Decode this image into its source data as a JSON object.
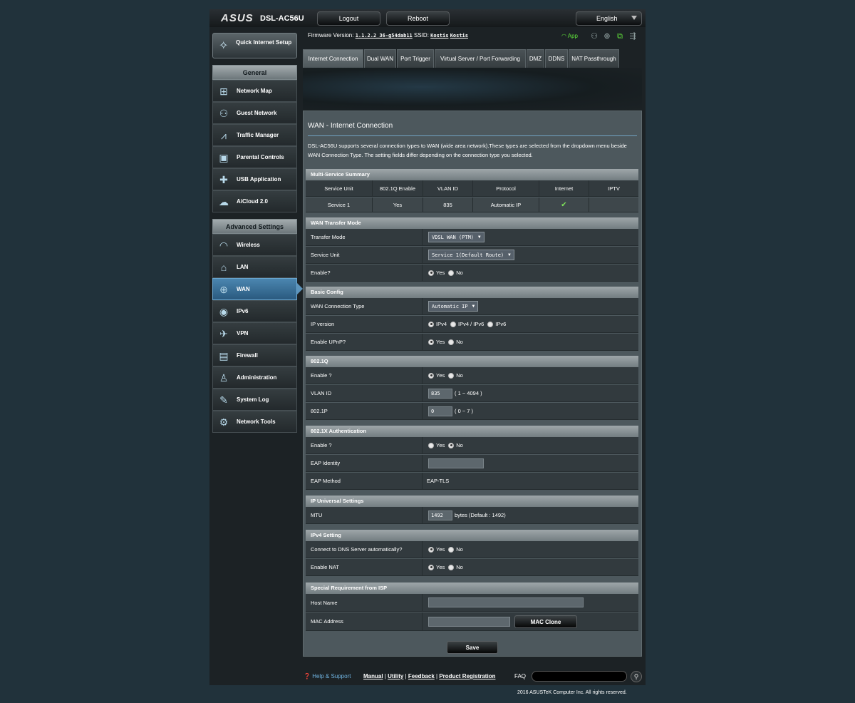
{
  "header": {
    "brand": "ASUS",
    "model": "DSL-AC56U",
    "logout_label": "Logout",
    "reboot_label": "Reboot",
    "language": "English"
  },
  "status_bar": {
    "firmware_label": "Firmware Version:",
    "firmware_value": "1.1.2.2_36-g54dab11",
    "ssid_label": "SSID:",
    "ssid_1": "Kostis",
    "ssid_2": "Kostis",
    "app_label": "App"
  },
  "sidebar": {
    "quick_setup_label": "Quick Internet Setup",
    "general_heading": "General",
    "general_items": [
      {
        "label": "Network Map"
      },
      {
        "label": "Guest Network"
      },
      {
        "label": "Traffic Manager"
      },
      {
        "label": "Parental Controls"
      },
      {
        "label": "USB Application"
      },
      {
        "label": "AiCloud 2.0"
      }
    ],
    "advanced_heading": "Advanced Settings",
    "advanced_items": [
      {
        "label": "Wireless"
      },
      {
        "label": "LAN"
      },
      {
        "label": "WAN"
      },
      {
        "label": "IPv6"
      },
      {
        "label": "VPN"
      },
      {
        "label": "Firewall"
      },
      {
        "label": "Administration"
      },
      {
        "label": "System Log"
      },
      {
        "label": "Network Tools"
      }
    ]
  },
  "tabs": [
    "Internet Connection",
    "Dual WAN",
    "Port Trigger",
    "Virtual Server / Port Forwarding",
    "DMZ",
    "DDNS",
    "NAT Passthrough"
  ],
  "page": {
    "title": "WAN - Internet Connection",
    "description": "DSL-AC56U supports several connection types to WAN (wide area network).These types are selected from the dropdown menu beside WAN Connection Type. The setting fields differ depending on the connection type you selected."
  },
  "multi_service": {
    "heading": "Multi-Service Summary",
    "columns": [
      "Service Unit",
      "802.1Q Enable",
      "VLAN ID",
      "Protocol",
      "Internet",
      "IPTV"
    ],
    "row": {
      "service_unit": "Service 1",
      "q_enable": "Yes",
      "vlan_id": "835",
      "protocol": "Automatic IP",
      "iptv": ""
    }
  },
  "wan_transfer": {
    "heading": "WAN Transfer Mode",
    "transfer_mode_label": "Transfer Mode",
    "transfer_mode_value": "VDSL WAN (PTM)",
    "service_unit_label": "Service Unit",
    "service_unit_value": "Service 1(Default Route)",
    "enable_label": "Enable?"
  },
  "basic_config": {
    "heading": "Basic Config",
    "conn_type_label": "WAN Connection Type",
    "conn_type_value": "Automatic IP",
    "ip_version_label": "IP version",
    "ip_opt_1": "IPv4",
    "ip_opt_2": "IPv4 / IPv6",
    "ip_opt_3": "IPv6",
    "upnp_label": "Enable UPnP?"
  },
  "dot1q": {
    "heading": "802.1Q",
    "enable_label": "Enable ?",
    "vlan_label": "VLAN ID",
    "vlan_value": "835",
    "vlan_range": "( 1 ~ 4094 )",
    "p_label": "802.1P",
    "p_value": "0",
    "p_range": "( 0 ~ 7 )"
  },
  "dot1x": {
    "heading": "802.1X Authentication",
    "enable_label": "Enable ?",
    "identity_label": "EAP Identity",
    "identity_value": "",
    "method_label": "EAP Method",
    "method_value": "EAP-TLS"
  },
  "ip_universal": {
    "heading": "IP Universal Settings",
    "mtu_label": "MTU",
    "mtu_value": "1492",
    "mtu_hint": "bytes (Default : 1492)"
  },
  "ipv4": {
    "heading": "IPv4 Setting",
    "dns_label": "Connect to DNS Server automatically?",
    "nat_label": "Enable NAT"
  },
  "isp": {
    "heading": "Special Requirement from ISP",
    "host_label": "Host Name",
    "host_value": "",
    "mac_label": "MAC Address",
    "mac_value": "",
    "mac_clone_label": "MAC Clone"
  },
  "radio": {
    "yes": "Yes",
    "no": "No"
  },
  "save_label": "Save",
  "footer": {
    "help_label": "Help & Support",
    "manual": "Manual",
    "utility": "Utility",
    "feedback": "Feedback",
    "registration": "Product Registration",
    "sep": "|",
    "faq_label": "FAQ",
    "faq_placeholder": "",
    "copyright": "2016 ASUSTeK Computer Inc. All rights reserved."
  },
  "colors": {
    "accent": "#4b86b0",
    "background": "#21323b",
    "panel": "#4d585d"
  }
}
